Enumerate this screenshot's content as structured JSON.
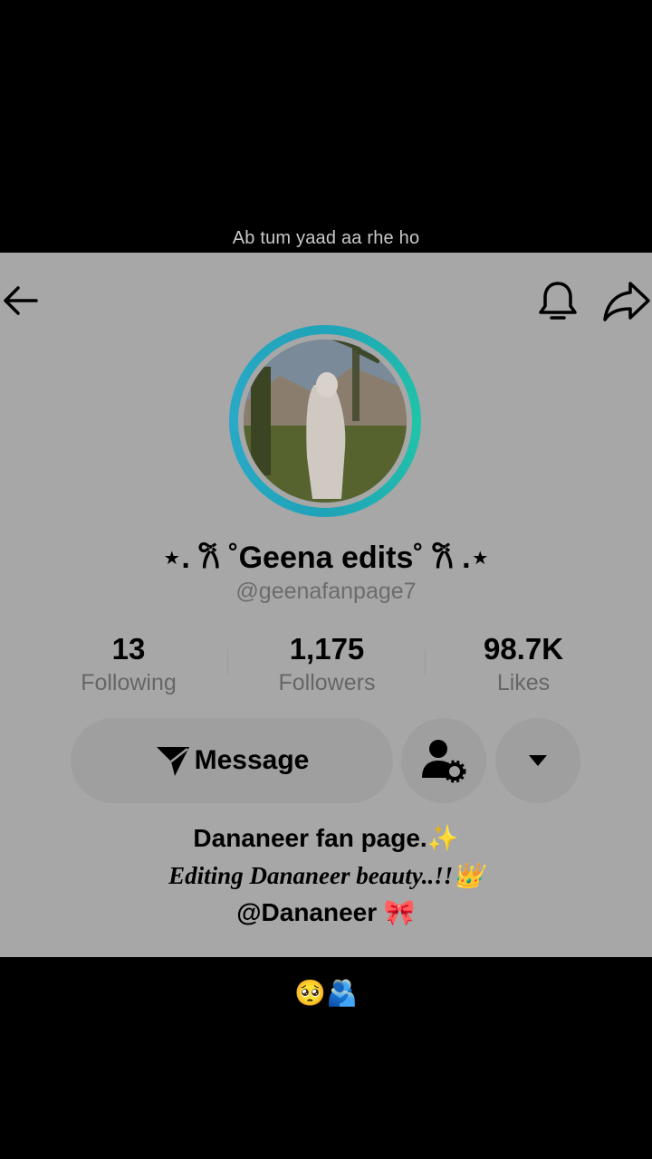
{
  "overlay": {
    "top_caption": "Ab tum yaad aa rhe ho",
    "bottom_emoji": "🥺🫂"
  },
  "profile": {
    "display_name": "⋆. 𐙚 ˚Geena edits˚ 𐙚 .⋆",
    "username": "@geenafanpage7",
    "stats": [
      {
        "value": "13",
        "label": "Following"
      },
      {
        "value": "1,175",
        "label": "Followers"
      },
      {
        "value": "98.7K",
        "label": "Likes"
      }
    ],
    "message_label": "Message",
    "bio": [
      "Dananeer fan page.✨",
      "Editing Dananeer beauty..!!👑",
      "@Dananeer 🎀"
    ]
  },
  "icons": {
    "back": "arrow-left-icon",
    "bell": "bell-icon",
    "share": "share-arrow-icon",
    "message": "send-plane-icon",
    "add_friend": "user-settings-icon",
    "more": "caret-down-icon"
  },
  "colors": {
    "panel_bg": "#a7a7a7",
    "ring_start": "#1fa3b8",
    "ring_end": "#20c5a8",
    "button_bg": "#9f9f9f"
  }
}
